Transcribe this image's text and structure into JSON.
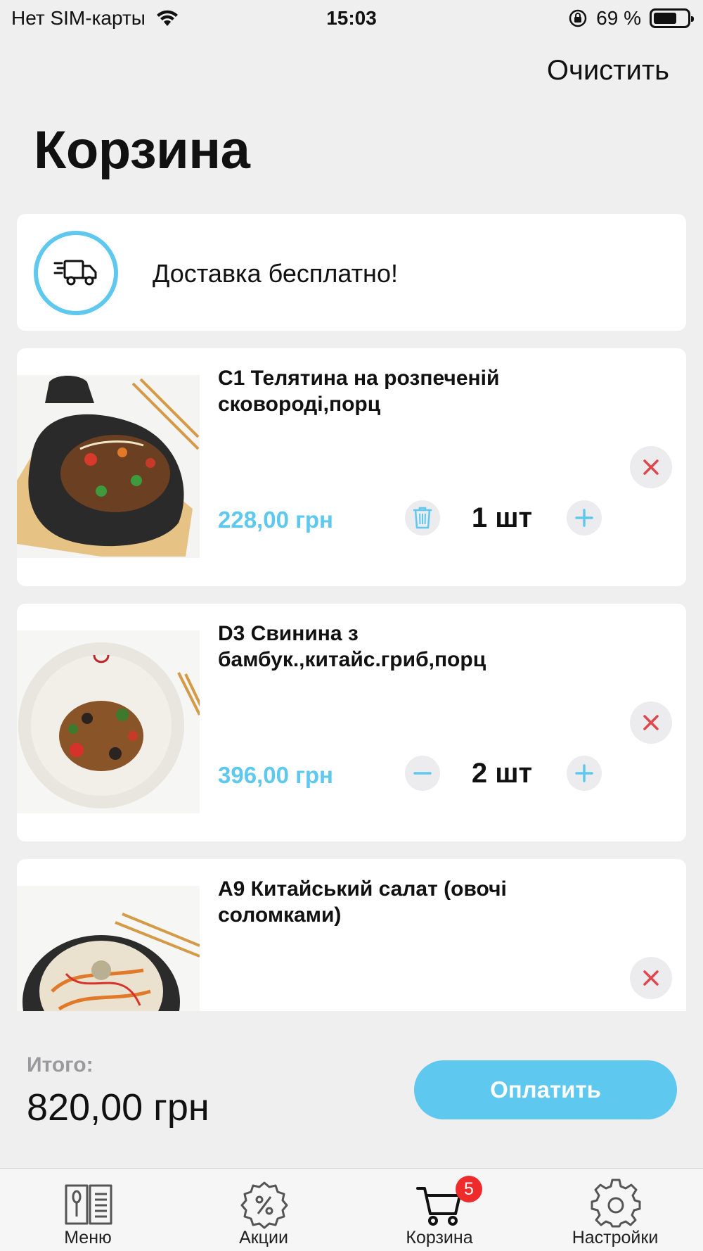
{
  "status_bar": {
    "carrier": "Нет SIM-карты",
    "time": "15:03",
    "battery": "69 %",
    "battery_level": 0.69
  },
  "header": {
    "clear_label": "Очистить",
    "title": "Корзина"
  },
  "delivery": {
    "text": "Доставка бесплатно!"
  },
  "items": [
    {
      "name": "C1 Телятина на розпеченій сковороді,порц",
      "price": "228,00 грн",
      "quantity": "1 шт"
    },
    {
      "name": "D3 Свинина з бамбук.,китайс.гриб,порц",
      "price": "396,00 грн",
      "quantity": "2 шт"
    },
    {
      "name": "A9 Китайський салат (овочі соломками)"
    }
  ],
  "footer": {
    "total_label": "Итого:",
    "total_value": "820,00 грн",
    "pay_label": "Оплатить"
  },
  "tabs": [
    {
      "label": "Меню"
    },
    {
      "label": "Акции"
    },
    {
      "label": "Корзина",
      "badge": "5"
    },
    {
      "label": "Настройки"
    }
  ],
  "colors": {
    "accent": "#5ec8ef",
    "remove": "#e0474c",
    "badge": "#ee2a2a"
  }
}
